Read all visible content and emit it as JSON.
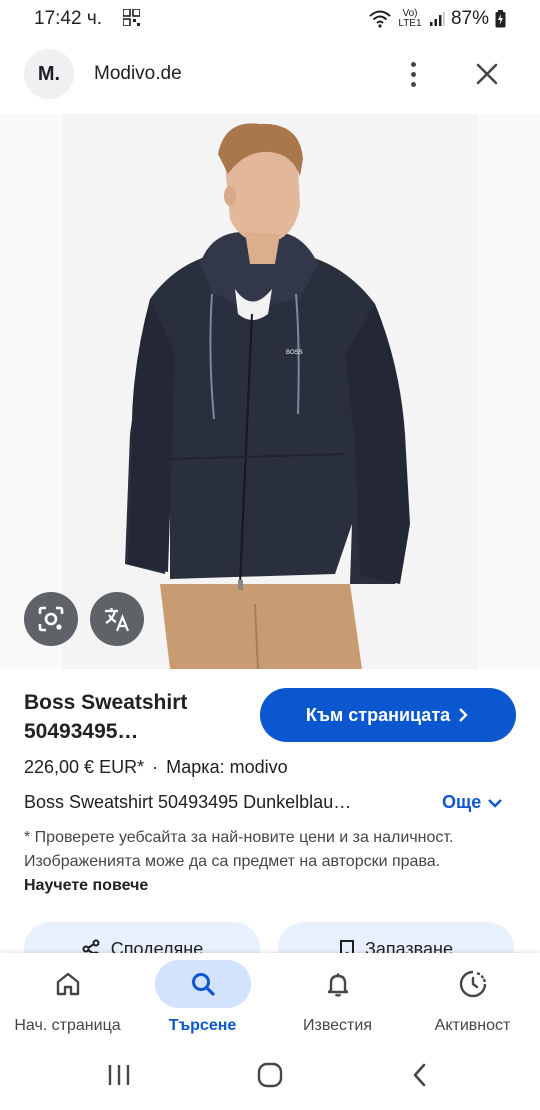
{
  "status_bar": {
    "time": "17:42 ч.",
    "network": "Vo) LTE1",
    "battery": "87%"
  },
  "header": {
    "avatar_letter": "M.",
    "site_name": "Modivo.de"
  },
  "product": {
    "title": "Boss Sweatshirt 50493495…",
    "visit_label": "Към страницата",
    "price": "226,00 € EUR*",
    "separator": "·",
    "brand": "Марка: modivo",
    "description": "Boss Sweatshirt 50493495 Dunkelblau…",
    "more_label": "Още",
    "notice": "* Проверете уебсайта за най-новите цени и за наличност. Изображенията може да са предмет на авторски права.",
    "learn_more": "Научете повече",
    "share_label": "Споделяне",
    "save_label": "Запазване"
  },
  "photo": {
    "logo_text": "BOSS"
  },
  "bottom_nav": {
    "items": [
      {
        "label": "Нач. страница",
        "icon": "home-icon"
      },
      {
        "label": "Търсене",
        "icon": "search-icon"
      },
      {
        "label": "Известия",
        "icon": "bell-icon"
      },
      {
        "label": "Активност",
        "icon": "activity-icon"
      }
    ]
  },
  "colors": {
    "accent": "#0b57d0",
    "accent_light": "#d3e3fd",
    "button_tint": "#e8f0fe",
    "hoodie": "#2a2f3d",
    "pants": "#c89b73"
  }
}
